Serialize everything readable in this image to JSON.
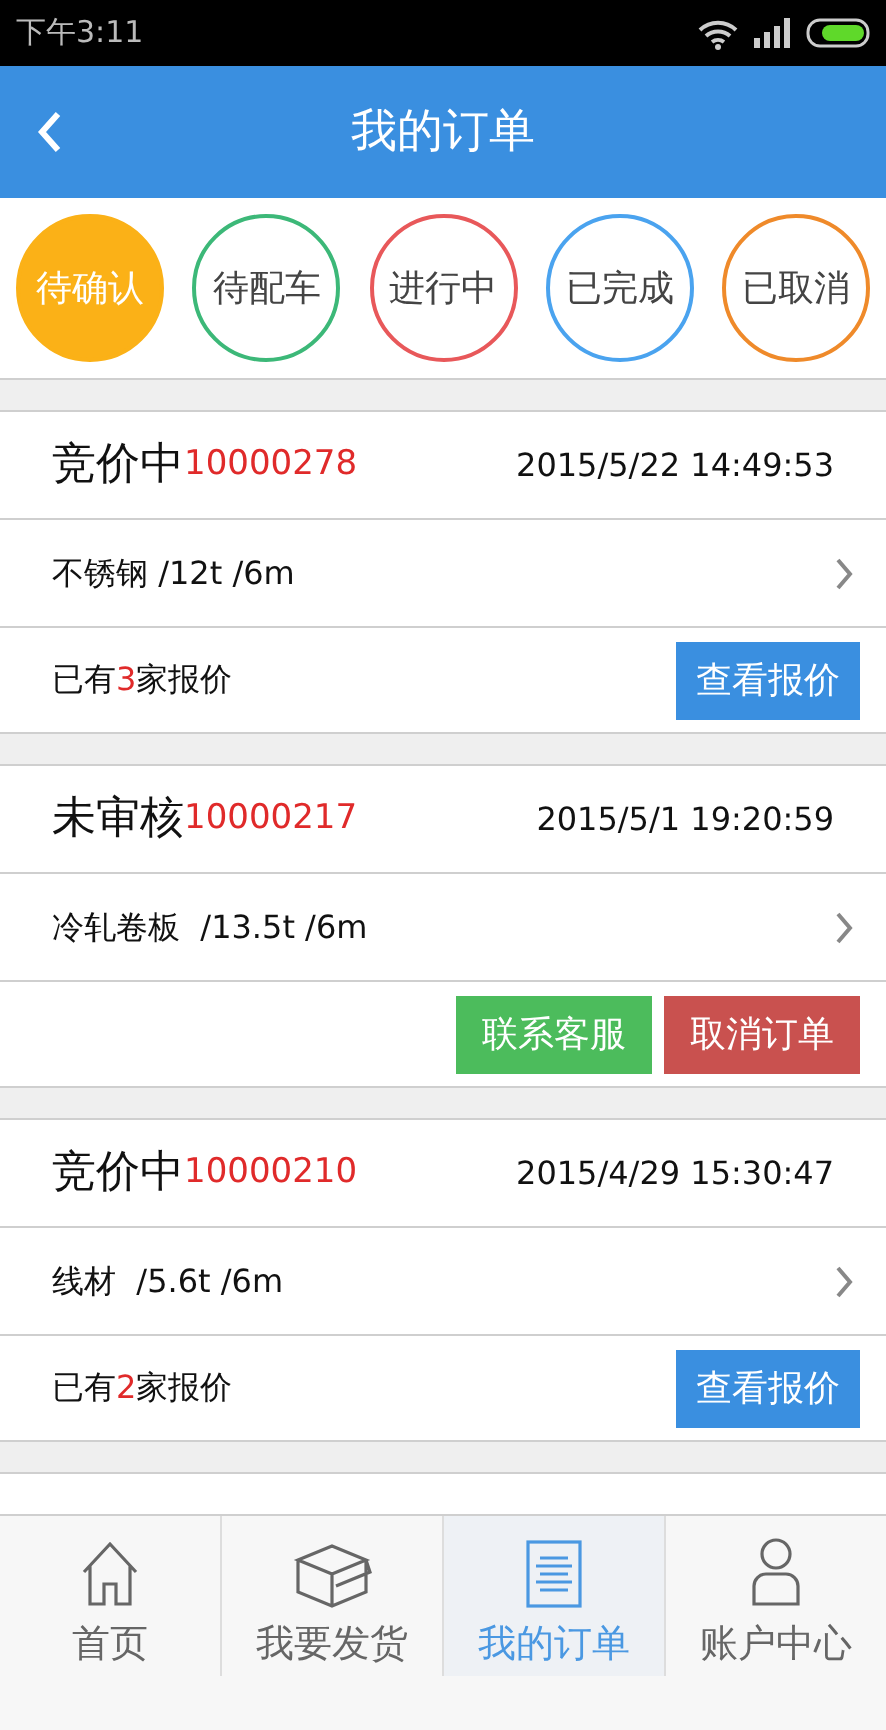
{
  "status_bar": {
    "time": "下午3:11"
  },
  "header": {
    "title": "我的订单"
  },
  "filters": [
    {
      "label": "待确认",
      "selected": true,
      "color": "#fbb117"
    },
    {
      "label": "待配车",
      "selected": false,
      "color": "#3cb878"
    },
    {
      "label": "进行中",
      "selected": false,
      "color": "#e8585a"
    },
    {
      "label": "已完成",
      "selected": false,
      "color": "#4aa3ef"
    },
    {
      "label": "已取消",
      "selected": false,
      "color": "#ef8a2a"
    }
  ],
  "orders": [
    {
      "status": "竞价中",
      "number": "10000278",
      "time": "2015/5/22 14:49:53",
      "goods": "不锈钢 /12t /6m",
      "footer": {
        "kind": "quotes",
        "before": "已有",
        "count": "3",
        "after": "家报价",
        "button": "查看报价"
      }
    },
    {
      "status": "未审核",
      "number": "10000217",
      "time": "2015/5/1 19:20:59",
      "goods": "冷轧卷板  /13.5t /6m",
      "footer": {
        "kind": "actions",
        "buttons": [
          {
            "label": "联系客服",
            "kind": "contact"
          },
          {
            "label": "取消订单",
            "kind": "cancel"
          }
        ]
      }
    },
    {
      "status": "竞价中",
      "number": "10000210",
      "time": "2015/4/29 15:30:47",
      "goods": "线材  /5.6t /6m",
      "footer": {
        "kind": "quotes",
        "before": "已有",
        "count": "2",
        "after": "家报价",
        "button": "查看报价"
      }
    }
  ],
  "tab_bar": [
    {
      "label": "首页",
      "selected": false
    },
    {
      "label": "我要发货",
      "selected": false
    },
    {
      "label": "我的订单",
      "selected": true
    },
    {
      "label": "账户中心",
      "selected": false
    }
  ]
}
